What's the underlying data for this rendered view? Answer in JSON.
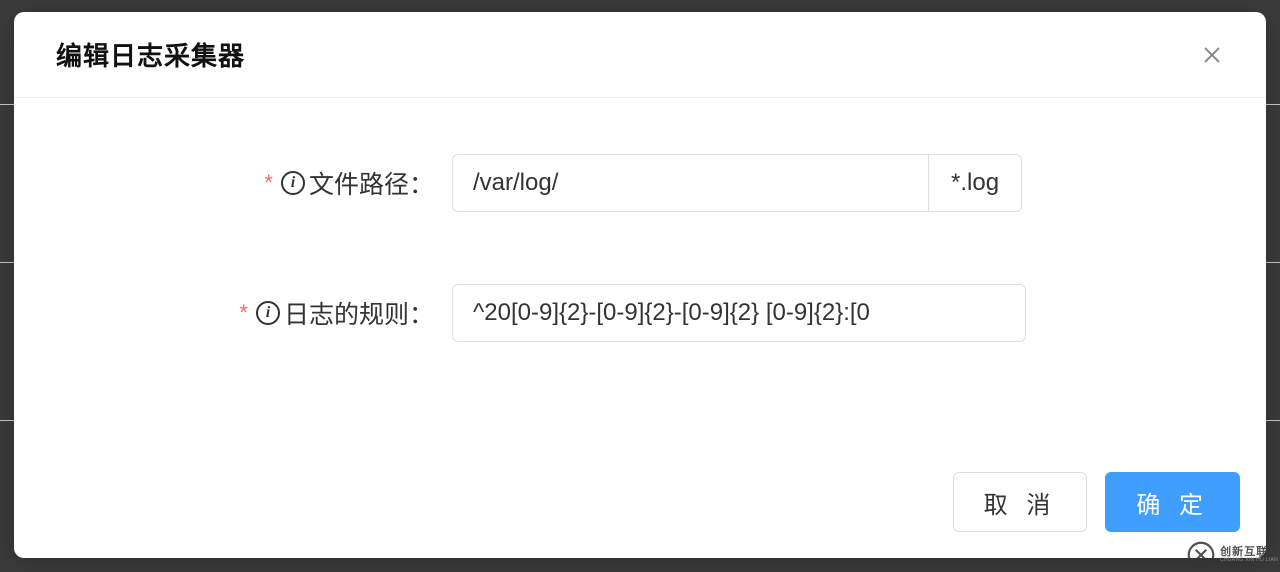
{
  "modal": {
    "title": "编辑日志采集器",
    "fields": {
      "file_path": {
        "label": "文件路径：",
        "value": "/var/log/",
        "addon": "*.log"
      },
      "log_rule": {
        "label": "日志的规则：",
        "value": "^20[0-9]{2}-[0-9]{2}-[0-9]{2} [0-9]{2}:[0"
      }
    },
    "buttons": {
      "cancel": "取 消",
      "confirm": "确 定"
    }
  },
  "watermark": {
    "main": "创新互联",
    "sub": "CHUANG XIN HU LIAN"
  }
}
